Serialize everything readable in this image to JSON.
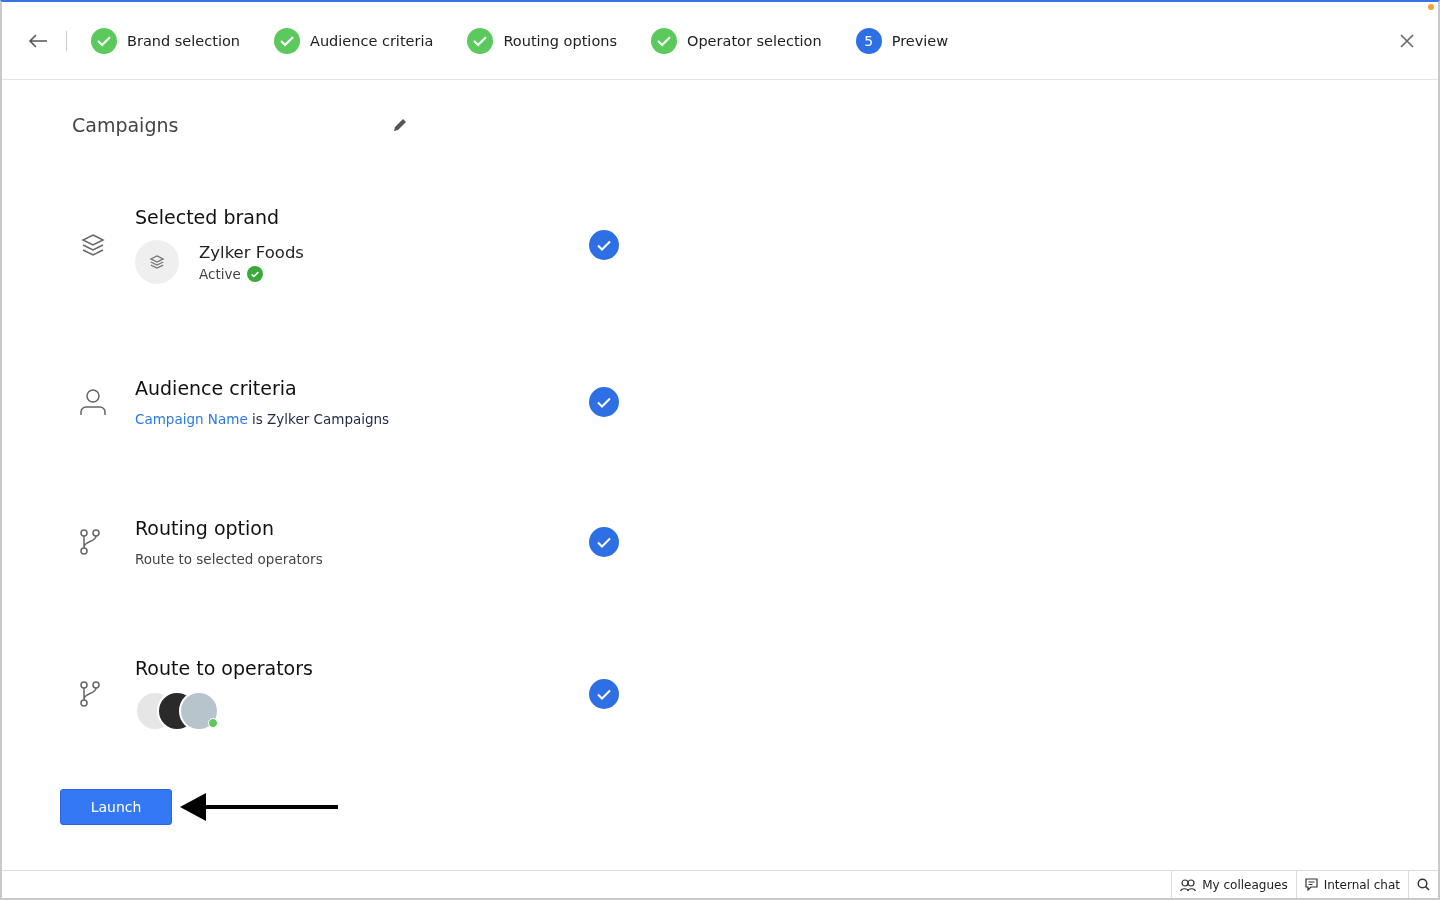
{
  "steps": [
    {
      "label": "Brand selection",
      "completed": true
    },
    {
      "label": "Audience criteria",
      "completed": true
    },
    {
      "label": "Routing options",
      "completed": true
    },
    {
      "label": "Operator selection",
      "completed": true
    },
    {
      "label": "Preview",
      "completed": false,
      "number": "5"
    }
  ],
  "title": "Campaigns",
  "sections": [
    {
      "kind": "brand",
      "heading": "Selected brand",
      "checked": true,
      "brand": {
        "name": "Zylker Foods",
        "status": "Active",
        "active": true
      }
    },
    {
      "kind": "criteria",
      "heading": "Audience criteria",
      "checked": true,
      "field": "Campaign Name",
      "rest": "is Zylker Campaigns"
    },
    {
      "kind": "text",
      "heading": "Routing option",
      "checked": true,
      "text": "Route to selected operators"
    },
    {
      "kind": "operators",
      "heading": "Route to operators",
      "checked": true,
      "operators": [
        {
          "online": false
        },
        {
          "online": false
        },
        {
          "online": true
        }
      ]
    }
  ],
  "launch": "Launch",
  "status_bar": {
    "items": [
      {
        "kind": "colleagues",
        "label": "My colleagues"
      },
      {
        "kind": "chat",
        "label": "Internal chat"
      },
      {
        "kind": "search"
      }
    ]
  }
}
